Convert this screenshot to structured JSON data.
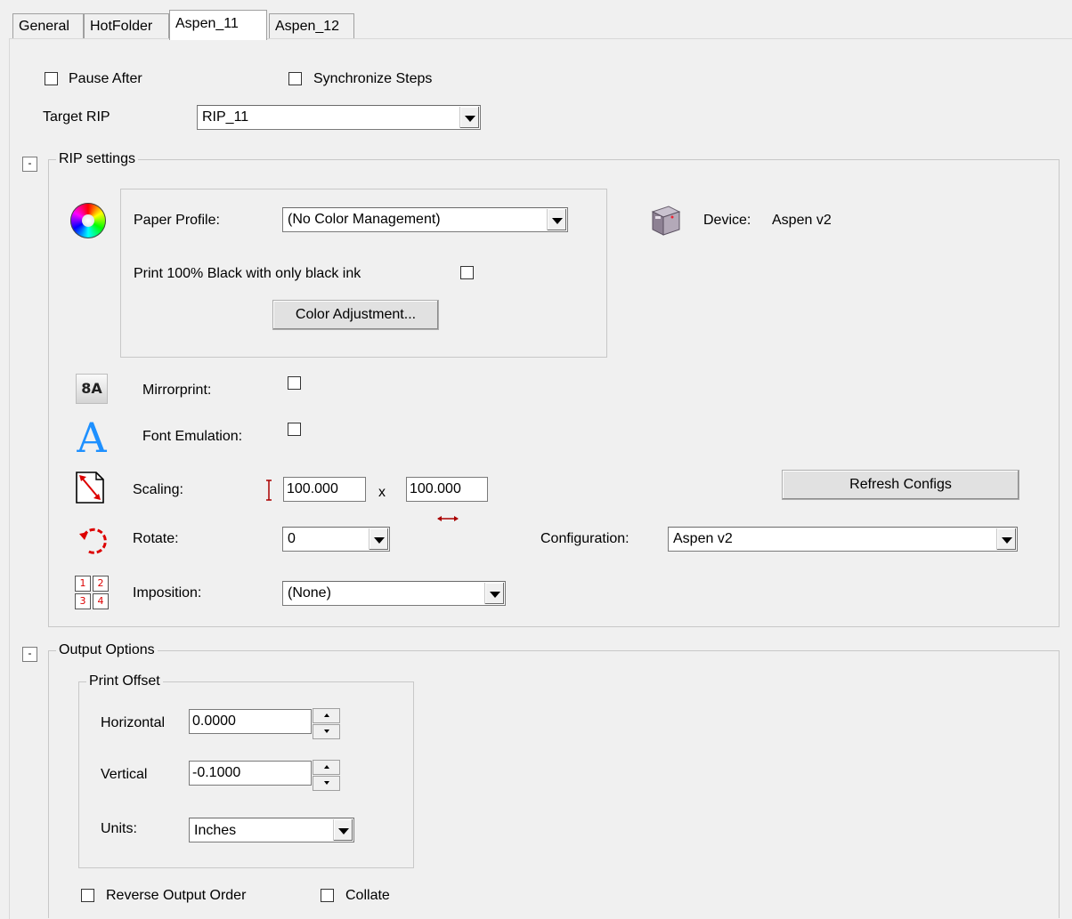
{
  "tabs": [
    "General",
    "HotFolder",
    "Aspen_11",
    "Aspen_12"
  ],
  "pause_after_label": "Pause After",
  "synchronize_steps_label": "Synchronize Steps",
  "target_rip": {
    "label": "Target RIP",
    "value": "RIP_11"
  },
  "rip_settings": {
    "legend": "RIP settings",
    "collapse_glyph": "-",
    "paper_profile": {
      "label": "Paper Profile:",
      "value": "(No Color Management)"
    },
    "print_black_label": "Print 100% Black with only black ink",
    "color_adjustment_button": "Color Adjustment...",
    "device_label": "Device:",
    "device_value": "Aspen v2",
    "mirrorprint_label": "Mirrorprint:",
    "mirror_icon_text": "8A",
    "font_emulation_label": "Font Emulation:",
    "font_icon_text": "A",
    "scaling_label": "Scaling:",
    "scale_vertical": "100.000",
    "scale_x": "x",
    "scale_horizontal": "100.000",
    "refresh_configs_button": "Refresh Configs",
    "rotate_label": "Rotate:",
    "rotate_value": "0",
    "configuration_label": "Configuration:",
    "configuration_value": "Aspen v2",
    "imposition_label": "Imposition:",
    "imposition_value": "(None)",
    "imposition_icon_digits": [
      "1",
      "2",
      "3",
      "4"
    ]
  },
  "output_options": {
    "legend": "Output Options",
    "collapse_glyph": "-",
    "print_offset": {
      "legend": "Print Offset",
      "horizontal_label": "Horizontal",
      "horizontal_value": "0.0000",
      "vertical_label": "Vertical",
      "vertical_value": "-0.1000",
      "units_label": "Units:",
      "units_value": "Inches"
    },
    "reverse_output_label": "Reverse Output Order",
    "collate_label": "Collate"
  },
  "colors": {
    "selected_tab_bg": "#ffffff",
    "window_bg": "#f0f0f0",
    "accent_red": "#c00000",
    "accent_blue": "#1e90ff"
  }
}
